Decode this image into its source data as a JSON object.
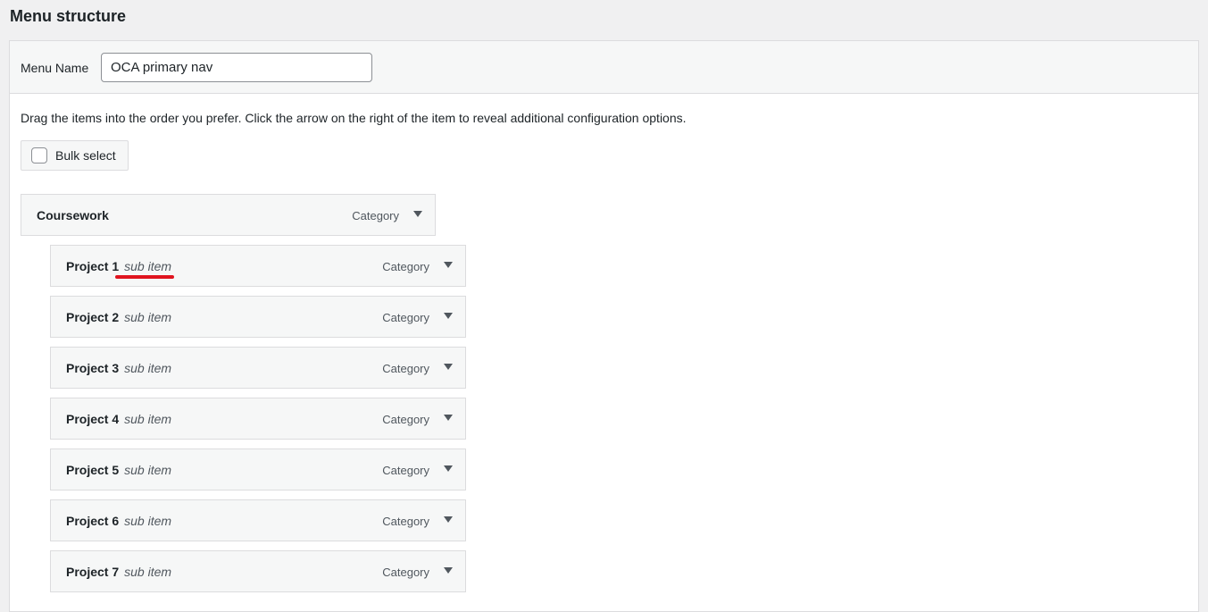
{
  "page": {
    "title": "Menu structure"
  },
  "menu": {
    "name_label": "Menu Name",
    "name_value": "OCA primary nav",
    "instructions": "Drag the items into the order you prefer. Click the arrow on the right of the item to reveal additional configuration options.",
    "bulk_select_label": "Bulk select",
    "bulk_select_checked": false
  },
  "items": [
    {
      "title": "Coursework",
      "sub": "",
      "type": "Category",
      "depth": 0
    },
    {
      "title": "Project 1",
      "sub": "sub item",
      "type": "Category",
      "depth": 1
    },
    {
      "title": "Project 2",
      "sub": "sub item",
      "type": "Category",
      "depth": 1
    },
    {
      "title": "Project 3",
      "sub": "sub item",
      "type": "Category",
      "depth": 1
    },
    {
      "title": "Project 4",
      "sub": "sub item",
      "type": "Category",
      "depth": 1
    },
    {
      "title": "Project 5",
      "sub": "sub item",
      "type": "Category",
      "depth": 1
    },
    {
      "title": "Project 6",
      "sub": "sub item",
      "type": "Category",
      "depth": 1
    },
    {
      "title": "Project 7",
      "sub": "sub item",
      "type": "Category",
      "depth": 1
    }
  ],
  "annotations": {
    "highlight_color": "#e0141f"
  },
  "icons": {
    "item_toggle": "triangle-down-icon",
    "checkbox": "checkbox-icon"
  }
}
